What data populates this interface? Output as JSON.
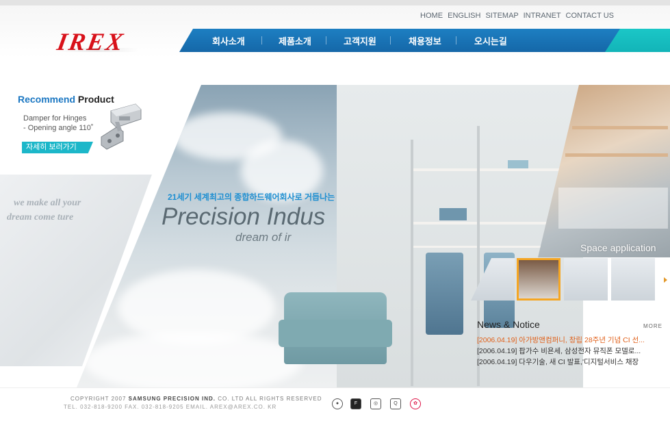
{
  "header": {
    "util_links": [
      "HOME",
      "ENGLISH",
      "SITEMAP",
      "INTRANET",
      "CONTACT US"
    ],
    "logo": "IREX",
    "nav": [
      "회사소개",
      "제품소개",
      "고객지원",
      "채용정보",
      "오시는길"
    ]
  },
  "recommend": {
    "title_accent": "Recommend",
    "title_rest": "Product",
    "desc_line1": "Damper for Hinges",
    "desc_line2": "- Opening angle 110˚",
    "button": "자세히 보러가기"
  },
  "sketch_text": {
    "line1": "we make all your",
    "line2": "dream come ture"
  },
  "hero": {
    "tagline": "21세기 세계최고의 종합하드웨어회사로 거듭나는",
    "headline": "Precision Indus",
    "subline": "dream of ir"
  },
  "space": {
    "label": "Space application"
  },
  "news": {
    "title": "News & Notice",
    "more": "MORE",
    "items": [
      "[2006.04.19]  아가방앤컴퍼니, 창립 28주년 기념 CI 선...",
      "[2006.04.19]  팝가수 비욘세, 삼성전자 뮤직폰 모델로...",
      "[2006.04.19]  다우기술, 새 CI 발표,'디지털서비스 채장"
    ]
  },
  "footer": {
    "copyright_pre": "COPYRIGHT 2007",
    "copyright_brand": "SAMSUNG PRECISION IND.",
    "copyright_post": "CO. LTD ALL RIGHTS RESERVED",
    "contact": "TEL. 032-818-9200   FAX. 032-818-9205   EMAIL. AREX@AREX.CO. KR",
    "cert_icons": [
      "cert-badge-icon",
      "fira-logo-icon",
      "cert-check-icon",
      "cert-q-icon",
      "cert-seal-icon"
    ]
  }
}
